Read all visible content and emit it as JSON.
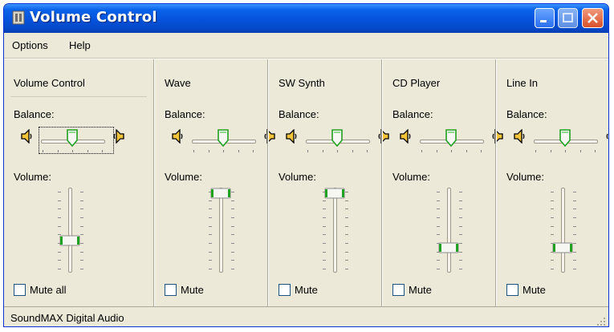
{
  "window": {
    "title": "Volume Control",
    "icon": "speaker-app-icon",
    "buttons": [
      "minimize-button",
      "maximize-button",
      "close-button"
    ]
  },
  "menu": [
    {
      "label": "Options"
    },
    {
      "label": "Help"
    }
  ],
  "columns": [
    {
      "title": "Volume Control",
      "balance_label": "Balance:",
      "volume_label": "Volume:",
      "balance": 0.5,
      "volume": 0.35,
      "mute_label": "Mute all",
      "muted": false,
      "focused": true
    },
    {
      "title": "Wave",
      "balance_label": "Balance:",
      "volume_label": "Volume:",
      "balance": 0.5,
      "volume": 1.0,
      "mute_label": "Mute",
      "muted": false,
      "focused": false
    },
    {
      "title": "SW Synth",
      "balance_label": "Balance:",
      "volume_label": "Volume:",
      "balance": 0.5,
      "volume": 1.0,
      "mute_label": "Mute",
      "muted": false,
      "focused": false
    },
    {
      "title": "CD Player",
      "balance_label": "Balance:",
      "volume_label": "Volume:",
      "balance": 0.5,
      "volume": 0.25,
      "mute_label": "Mute",
      "muted": false,
      "focused": false
    },
    {
      "title": "Line In",
      "balance_label": "Balance:",
      "volume_label": "Volume:",
      "balance": 0.5,
      "volume": 0.25,
      "mute_label": "Mute",
      "muted": false,
      "focused": false
    }
  ],
  "status": {
    "text": "SoundMAX Digital Audio"
  },
  "colors": {
    "title_bar": "#0553dc",
    "window_face": "#ece9d8",
    "slider_green": "#21a121"
  }
}
